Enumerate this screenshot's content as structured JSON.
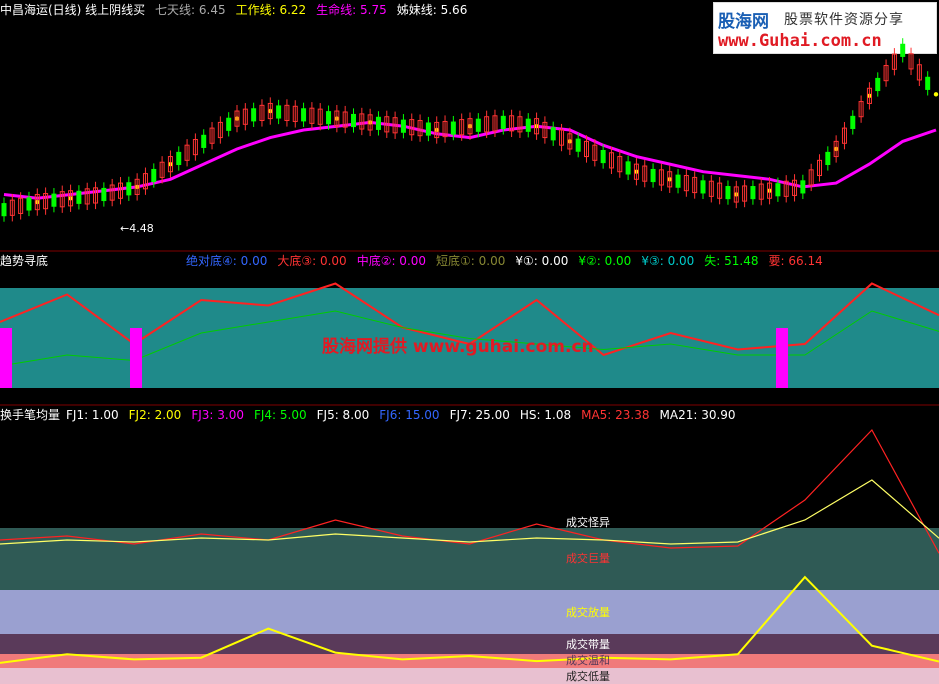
{
  "panel1": {
    "title": "中昌海运(日线) 线上阴线买",
    "indicators": [
      {
        "label": "七天线:",
        "value": "6.45",
        "color": "#aaaaaa"
      },
      {
        "label": "工作线:",
        "value": "6.22",
        "color": "#ffff00"
      },
      {
        "label": "生命线:",
        "value": "5.75",
        "color": "#ff00ff"
      },
      {
        "label": "姊妹线:",
        "value": "5.66",
        "color": "#ffffff"
      }
    ],
    "low_label": "←4.48"
  },
  "panel2": {
    "title": "趋势寻底",
    "indicators": [
      {
        "label": "绝对底④:",
        "value": "0.00",
        "color": "#3366ff"
      },
      {
        "label": "大底③:",
        "value": "0.00",
        "color": "#ff3333"
      },
      {
        "label": "中底②:",
        "value": "0.00",
        "color": "#ff00ff"
      },
      {
        "label": "短底①:",
        "value": "0.00",
        "color": "#888833"
      },
      {
        "label": "¥①:",
        "value": "0.00",
        "color": "#ffffff"
      },
      {
        "label": "¥②:",
        "value": "0.00",
        "color": "#00ff00"
      },
      {
        "label": "¥③:",
        "value": "0.00",
        "color": "#00cccc"
      },
      {
        "label": "失:",
        "value": "51.48",
        "color": "#00ff00"
      },
      {
        "label": "要:",
        "value": "66.14",
        "color": "#ff3333"
      }
    ],
    "watermark": "股海网提供 www.guhai.com.cn"
  },
  "panel3": {
    "title": "换手笔均量",
    "indicators": [
      {
        "label": "FJ1:",
        "value": "1.00",
        "color": "#ffffff"
      },
      {
        "label": "FJ2:",
        "value": "2.00",
        "color": "#ffff00"
      },
      {
        "label": "FJ3:",
        "value": "3.00",
        "color": "#ff00ff"
      },
      {
        "label": "FJ4:",
        "value": "5.00",
        "color": "#00ff00"
      },
      {
        "label": "FJ5:",
        "value": "8.00",
        "color": "#ffffff"
      },
      {
        "label": "FJ6:",
        "value": "15.00",
        "color": "#3366ff"
      },
      {
        "label": "FJ7:",
        "value": "25.00",
        "color": "#ffffff"
      },
      {
        "label": "HS:",
        "value": "1.08",
        "color": "#ffffff"
      },
      {
        "label": "MA5:",
        "value": "23.38",
        "color": "#ff3333"
      },
      {
        "label": "MA21:",
        "value": "30.90",
        "color": "#ffffff"
      }
    ],
    "zones": [
      "成交怪异",
      "成交巨量",
      "成交放量",
      "成交带量",
      "成交温和",
      "成交低量"
    ]
  },
  "logo": {
    "line1": "股海网",
    "line2": "股票软件资源分享",
    "line3": "www.Guhai.com.cn"
  },
  "colors": {
    "up": "#ff3333",
    "down": "#00ff00",
    "life": "#ff00ff",
    "work": "#ffff00"
  },
  "chart_data": [
    {
      "type": "line",
      "x": [
        0,
        5,
        10,
        15,
        20,
        25,
        30,
        35,
        40,
        45,
        50,
        55,
        60,
        65,
        70,
        75,
        80,
        85,
        90,
        95,
        100,
        105,
        110,
        115,
        120,
        125,
        130,
        135,
        140
      ],
      "series": [
        {
          "name": "生命线",
          "values": [
            4.9,
            4.85,
            4.9,
            4.95,
            5.0,
            5.1,
            5.3,
            5.5,
            5.65,
            5.75,
            5.8,
            5.85,
            5.8,
            5.7,
            5.65,
            5.75,
            5.8,
            5.75,
            5.55,
            5.4,
            5.3,
            5.2,
            5.15,
            5.1,
            5.0,
            5.05,
            5.3,
            5.6,
            5.75
          ]
        },
        {
          "name": "工作线",
          "values": [
            4.7,
            4.8,
            4.85,
            4.9,
            5.0,
            5.3,
            5.6,
            5.9,
            6.0,
            5.95,
            5.9,
            5.85,
            5.8,
            5.75,
            5.8,
            5.85,
            5.8,
            5.6,
            5.4,
            5.2,
            5.1,
            5.0,
            4.9,
            4.95,
            5.0,
            5.5,
            6.2,
            6.8,
            6.22
          ]
        }
      ]
    },
    {
      "type": "line",
      "x": [
        0,
        10,
        20,
        30,
        40,
        50,
        60,
        70,
        80,
        90,
        100,
        110,
        120,
        130,
        140
      ],
      "series": [
        {
          "name": "要",
          "values": [
            60,
            85,
            40,
            80,
            75,
            95,
            55,
            40,
            80,
            30,
            50,
            35,
            40,
            95,
            66.14
          ]
        },
        {
          "name": "失",
          "values": [
            20,
            30,
            25,
            50,
            60,
            70,
            55,
            45,
            40,
            35,
            40,
            30,
            30,
            70,
            51.48
          ]
        }
      ]
    },
    {
      "type": "line",
      "x": [
        0,
        10,
        20,
        30,
        40,
        50,
        60,
        70,
        80,
        90,
        100,
        110,
        120,
        130,
        140
      ],
      "series": [
        {
          "name": "MA5",
          "values": [
            30,
            32,
            28,
            33,
            30,
            40,
            32,
            28,
            38,
            30,
            26,
            27,
            50,
            85,
            23.38
          ]
        },
        {
          "name": "MA21",
          "values": [
            28,
            30,
            29,
            31,
            30,
            33,
            31,
            29,
            31,
            30,
            28,
            29,
            40,
            60,
            30.9
          ]
        },
        {
          "name": "HS",
          "values": [
            1,
            1.5,
            1.2,
            1.3,
            3,
            1.6,
            1.2,
            1.4,
            1.1,
            1.3,
            1.2,
            1.5,
            6,
            2,
            1.08
          ]
        }
      ]
    }
  ]
}
